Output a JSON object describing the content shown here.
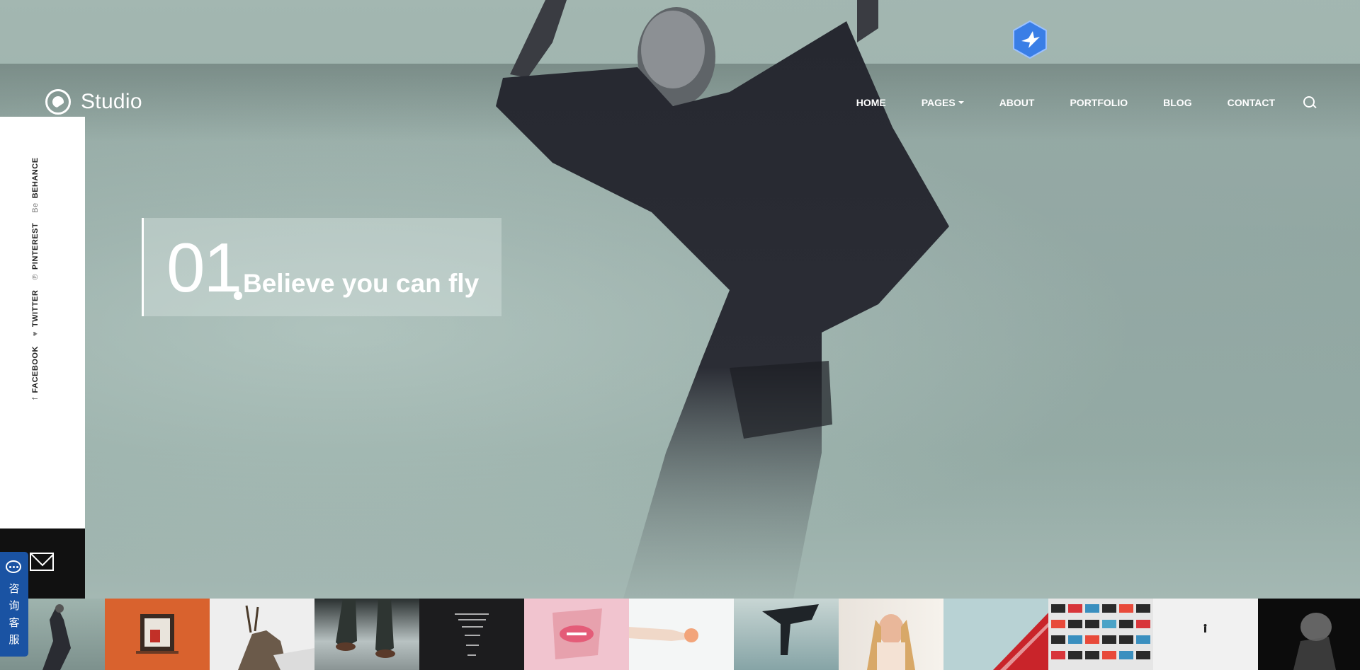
{
  "brand": {
    "name": "Studio"
  },
  "nav": {
    "items": [
      {
        "label": "HOME"
      },
      {
        "label": "PAGES",
        "has_dropdown": true
      },
      {
        "label": "ABOUT"
      },
      {
        "label": "PORTFOLIO"
      },
      {
        "label": "BLOG"
      },
      {
        "label": "CONTACT"
      }
    ]
  },
  "social": {
    "links": [
      {
        "label": "FACEBOOK",
        "icon": "f"
      },
      {
        "label": "TWITTER",
        "icon": "♥"
      },
      {
        "label": "PINTEREST",
        "icon": "℗"
      },
      {
        "label": "BEHANCE",
        "icon": "Be"
      }
    ]
  },
  "slide": {
    "number": "01",
    "title": "Believe you can fly"
  },
  "chat_widget": {
    "label_lines": [
      "咨",
      "询",
      "客",
      "服"
    ]
  },
  "colors": {
    "chat": "#1a53a3",
    "badge": "#3a7ee6",
    "sidebar": "#ffffff",
    "mail_box": "#111111"
  },
  "thumbnails": [
    {
      "icon": "dancer-thumb"
    },
    {
      "icon": "orange-wall-thumb"
    },
    {
      "icon": "deer-thumb"
    },
    {
      "icon": "boots-thumb"
    },
    {
      "icon": "dark-lines-thumb"
    },
    {
      "icon": "pink-lips-thumb"
    },
    {
      "icon": "hand-flower-thumb"
    },
    {
      "icon": "cape-figure-thumb"
    },
    {
      "icon": "woman-curtain-thumb"
    },
    {
      "icon": "red-building-thumb"
    },
    {
      "icon": "colorful-facade-thumb"
    },
    {
      "icon": "snow-walker-thumb"
    },
    {
      "icon": "smoke-portrait-thumb"
    }
  ]
}
